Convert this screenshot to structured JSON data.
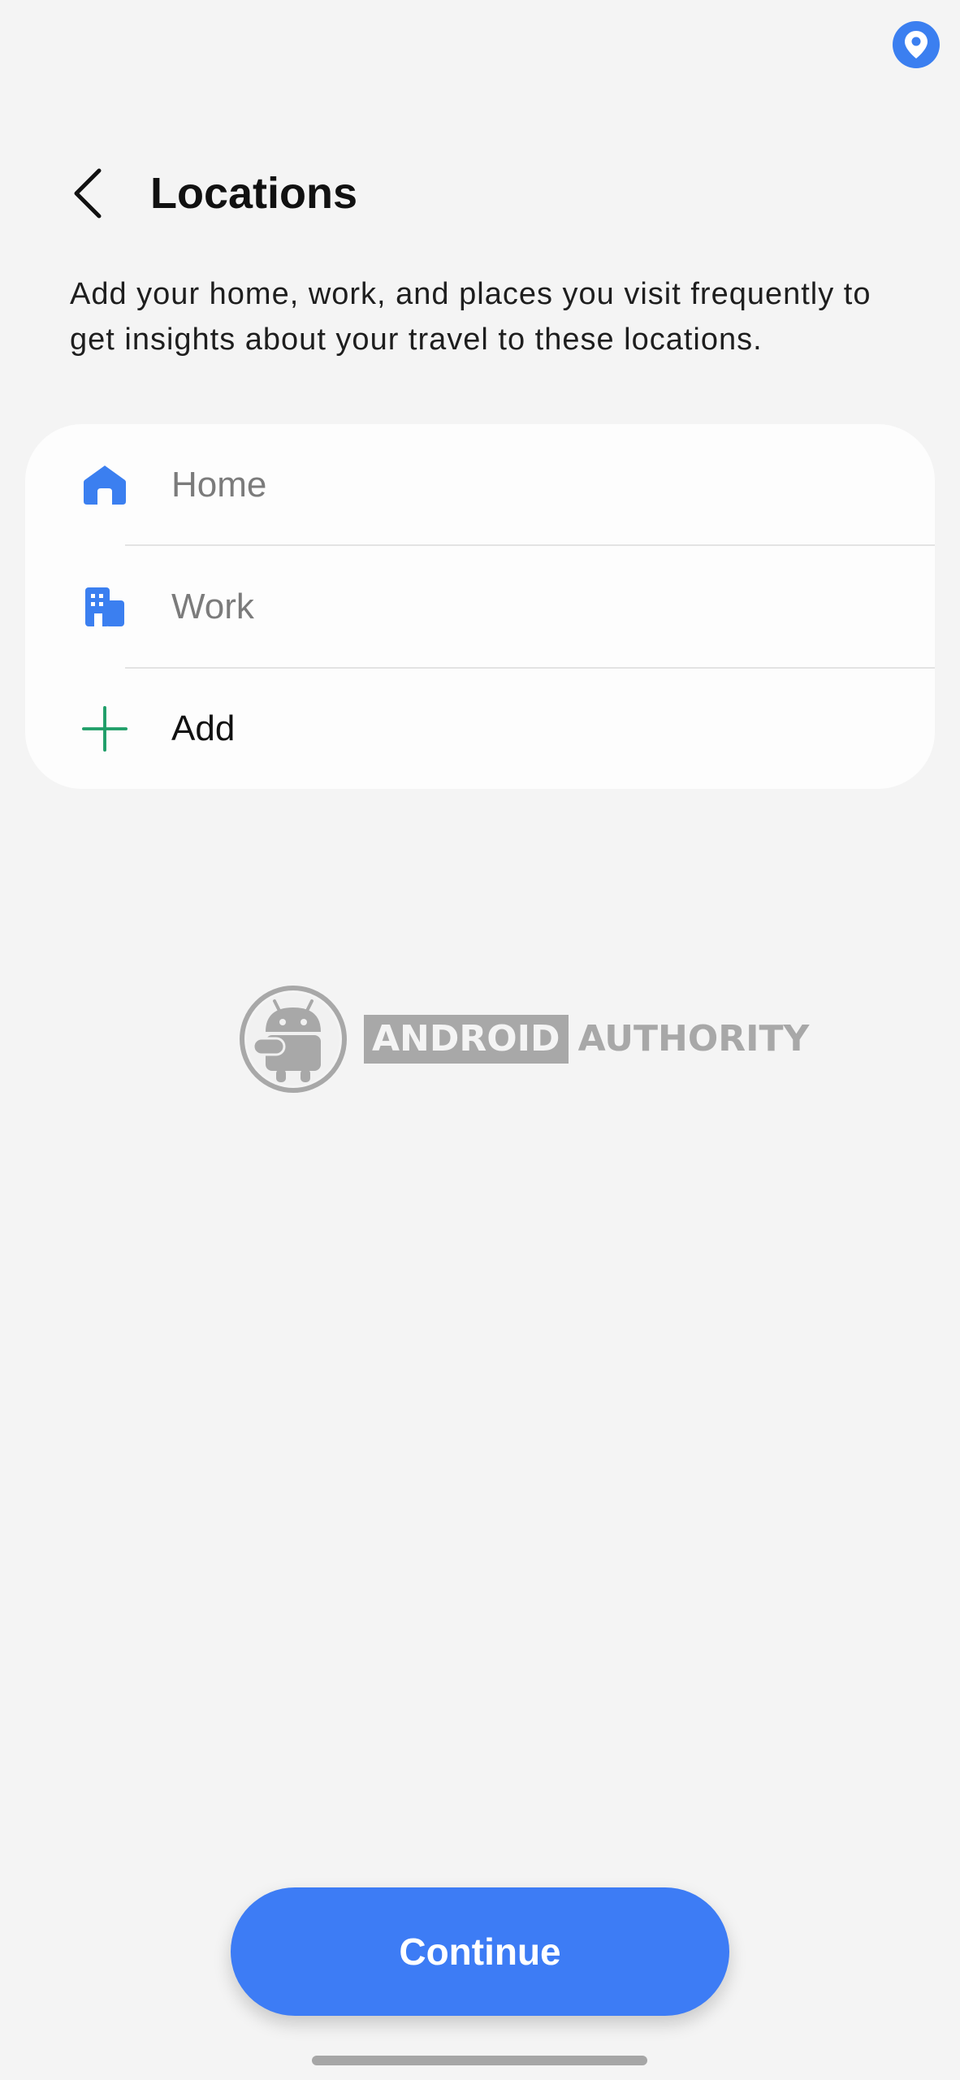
{
  "header": {
    "title": "Locations",
    "description": "Add your home, work, and places you visit frequently to get insights about your travel to these locations."
  },
  "locations": {
    "items": [
      {
        "label": "Home",
        "icon": "home-icon"
      },
      {
        "label": "Work",
        "icon": "building-icon"
      },
      {
        "label": "Add",
        "icon": "plus-icon"
      }
    ]
  },
  "watermark": {
    "part1": "ANDROID",
    "part2": "AUTHORITY"
  },
  "footer": {
    "continue_label": "Continue"
  },
  "colors": {
    "accent": "#3d7cf5",
    "icon_blue": "#3b7ff0",
    "plus_green": "#1e9e68",
    "background": "#f4f4f4"
  }
}
